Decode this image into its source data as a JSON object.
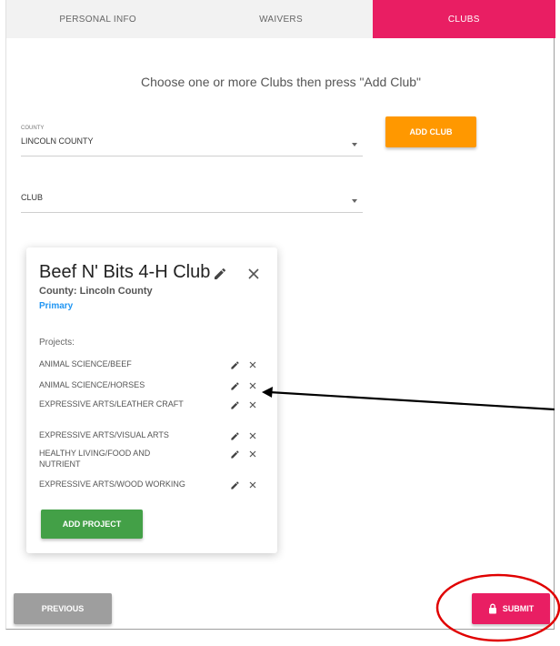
{
  "tabs": [
    {
      "label": "PERSONAL INFO",
      "active": false
    },
    {
      "label": "WAIVERS",
      "active": false
    },
    {
      "label": "CLUBS",
      "active": true
    }
  ],
  "instruction": "Choose one or more Clubs then press \"Add Club\"",
  "county_field": {
    "label": "COUNTY",
    "value": "LINCOLN COUNTY"
  },
  "club_field": {
    "label": "CLUB",
    "value": ""
  },
  "add_club_label": "ADD CLUB",
  "club_card": {
    "title": "Beef N' Bits 4-H Club",
    "county": "County: Lincoln County",
    "primary": "Primary",
    "projects_label": "Projects:",
    "projects": [
      "ANIMAL SCIENCE/BEEF",
      "ANIMAL SCIENCE/HORSES",
      "EXPRESSIVE ARTS/LEATHER CRAFT",
      "EXPRESSIVE ARTS/VISUAL ARTS",
      "HEALTHY LIVING/FOOD AND NUTRIENT",
      "EXPRESSIVE ARTS/WOOD WORKING"
    ],
    "add_project_label": "ADD PROJECT"
  },
  "previous_label": "PREVIOUS",
  "submit_label": "SUBMIT",
  "colors": {
    "accent": "#e91e63",
    "add_club": "#ff9800",
    "add_project": "#43a047",
    "primary_link": "#2196f3",
    "previous": "#9e9e9e",
    "annotation": "#e00000"
  },
  "icons": [
    "pencil-icon",
    "close-icon",
    "lock-icon",
    "dropdown-caret-icon"
  ]
}
